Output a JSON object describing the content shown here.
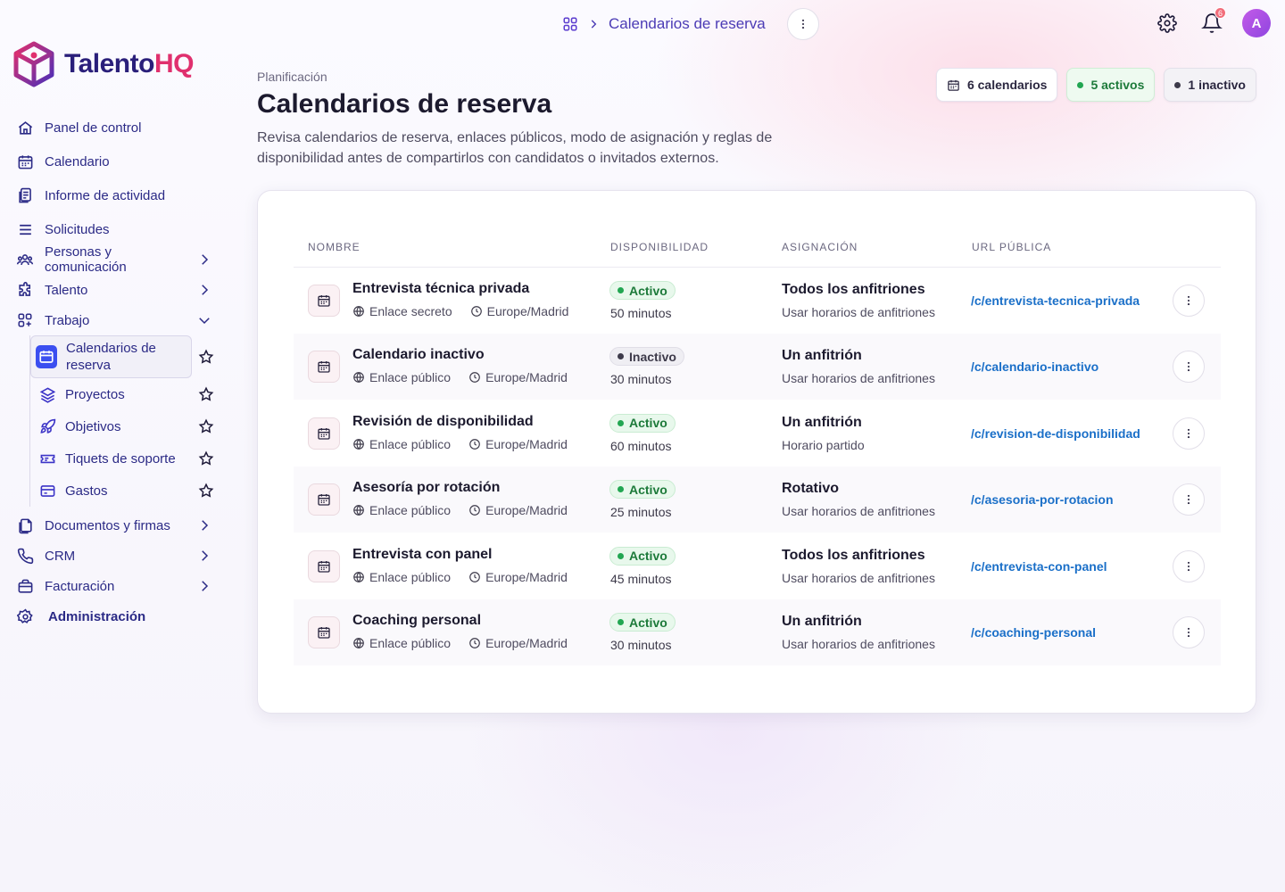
{
  "app": {
    "brand_main": "Talento",
    "brand_accent": "HQ"
  },
  "topbar": {
    "breadcrumb_title": "Calendarios de reserva",
    "notifications_count": "6",
    "avatar_initial": "A"
  },
  "sidebar": {
    "items": [
      {
        "label": "Panel de control",
        "icon": "home-icon"
      },
      {
        "label": "Calendario",
        "icon": "calendar-icon"
      },
      {
        "label": "Informe de actividad",
        "icon": "report-icon"
      },
      {
        "label": "Solicitudes",
        "icon": "list-icon"
      },
      {
        "label": "Personas y comunicación",
        "icon": "people-icon"
      },
      {
        "label": "Talento",
        "icon": "puzzle-icon"
      },
      {
        "label": "Trabajo",
        "icon": "grid-icon"
      },
      {
        "label": "Documentos y firmas",
        "icon": "documents-icon"
      },
      {
        "label": "CRM",
        "icon": "phone-icon"
      },
      {
        "label": "Facturación",
        "icon": "billing-icon"
      },
      {
        "label": "Administración",
        "icon": "gear-icon"
      }
    ],
    "work_subitems": [
      {
        "label": "Calendarios de reserva",
        "icon": "calendar-icon",
        "active": true
      },
      {
        "label": "Proyectos",
        "icon": "layers-icon"
      },
      {
        "label": "Objetivos",
        "icon": "rocket-icon"
      },
      {
        "label": "Tiquets de soporte",
        "icon": "ticket-icon"
      },
      {
        "label": "Gastos",
        "icon": "card-icon"
      }
    ]
  },
  "header": {
    "eyebrow": "Planificación",
    "title": "Calendarios de reserva",
    "description": "Revisa calendarios de reserva, enlaces públicos, modo de asignación y reglas de disponibilidad antes de compartirlos con candidatos o invitados externos."
  },
  "stats": {
    "total": "6 calendarios",
    "active": "5 activos",
    "inactive": "1 inactivo"
  },
  "table": {
    "columns": [
      "NOMBRE",
      "DISPONIBILIDAD",
      "ASIGNACIÓN",
      "URL PÚBLICA"
    ],
    "rows": [
      {
        "name": "Entrevista técnica privada",
        "link_type": "Enlace secreto",
        "timezone": "Europe/Madrid",
        "status": "Activo",
        "duration": "50 minutos",
        "assignment": "Todos los anfitriones",
        "schedule": "Usar horarios de anfitriones",
        "url": "/c/entrevista-tecnica-privada"
      },
      {
        "name": "Calendario inactivo",
        "link_type": "Enlace público",
        "timezone": "Europe/Madrid",
        "status": "Inactivo",
        "duration": "30 minutos",
        "assignment": "Un anfitrión",
        "schedule": "Usar horarios de anfitriones",
        "url": "/c/calendario-inactivo"
      },
      {
        "name": "Revisión de disponibilidad",
        "link_type": "Enlace público",
        "timezone": "Europe/Madrid",
        "status": "Activo",
        "duration": "60 minutos",
        "assignment": "Un anfitrión",
        "schedule": "Horario partido",
        "url": "/c/revision-de-disponibilidad"
      },
      {
        "name": "Asesoría por rotación",
        "link_type": "Enlace público",
        "timezone": "Europe/Madrid",
        "status": "Activo",
        "duration": "25 minutos",
        "assignment": "Rotativo",
        "schedule": "Usar horarios de anfitriones",
        "url": "/c/asesoria-por-rotacion"
      },
      {
        "name": "Entrevista con panel",
        "link_type": "Enlace público",
        "timezone": "Europe/Madrid",
        "status": "Activo",
        "duration": "45 minutos",
        "assignment": "Todos los anfitriones",
        "schedule": "Usar horarios de anfitriones",
        "url": "/c/entrevista-con-panel"
      },
      {
        "name": "Coaching personal",
        "link_type": "Enlace público",
        "timezone": "Europe/Madrid",
        "status": "Activo",
        "duration": "30 minutos",
        "assignment": "Un anfitrión",
        "schedule": "Usar horarios de anfitriones",
        "url": "/c/coaching-personal"
      }
    ]
  },
  "colors": {
    "brand_primary": "#2a1f7a",
    "brand_accent": "#e0306e",
    "link": "#1a6fc8",
    "active_green": "#22a652"
  }
}
